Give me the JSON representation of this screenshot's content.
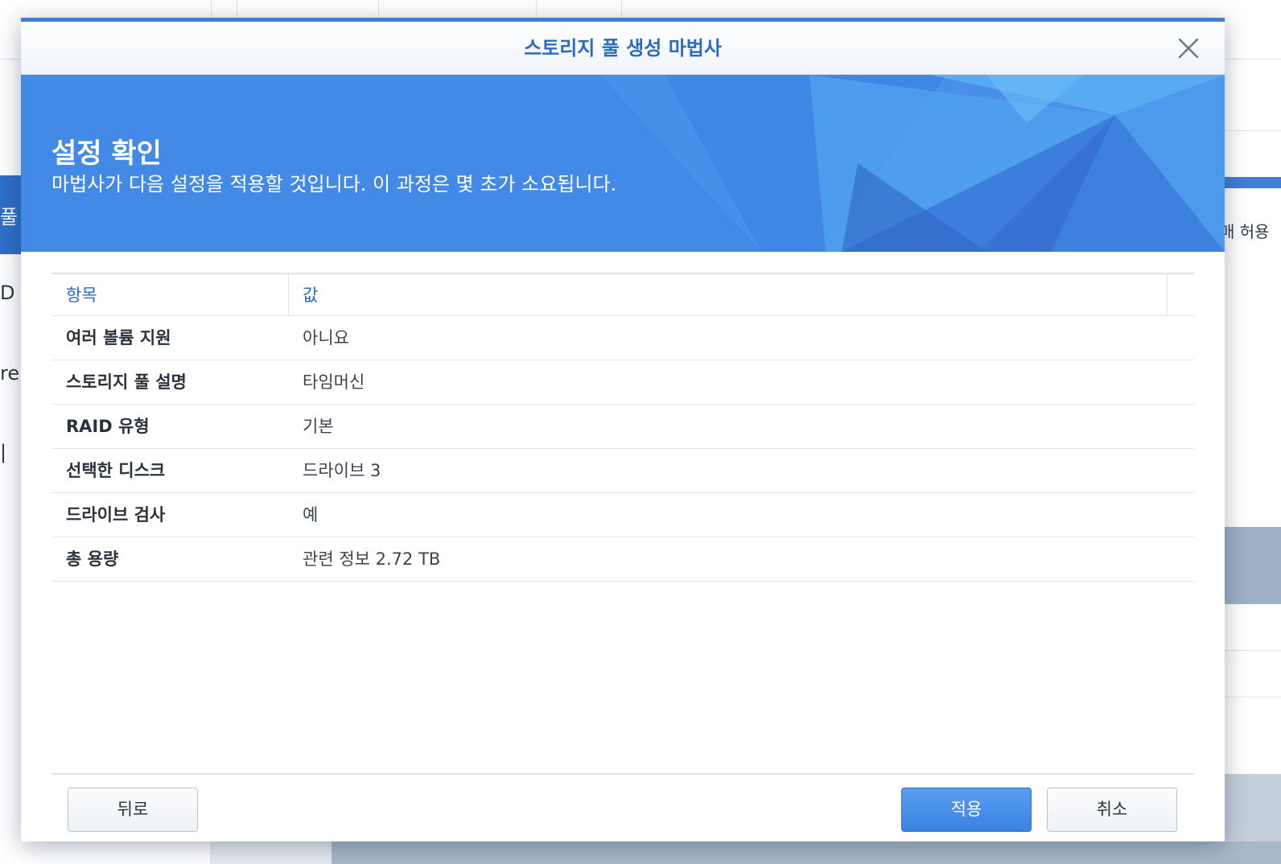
{
  "background": {
    "sidebar_fragments": [
      "풀",
      "D",
      "re",
      "|"
    ],
    "right_fragment": "매 허용"
  },
  "dialog": {
    "title": "스토리지 풀 생성 마법사",
    "close_icon": "close-icon",
    "banner": {
      "heading": "설정 확인",
      "subtitle": "마법사가 다음 설정을 적용할 것입니다. 이 과정은 몇 초가 소요됩니다."
    },
    "table": {
      "headers": [
        "항목",
        "값"
      ],
      "rows": [
        {
          "key": "여러 볼륨 지원",
          "value": "아니요"
        },
        {
          "key": "스토리지 풀 설명",
          "value": "타임머신"
        },
        {
          "key": "RAID 유형",
          "value": "기본"
        },
        {
          "key": "선택한 디스크",
          "value": "드라이브 3"
        },
        {
          "key": "드라이브 검사",
          "value": "예"
        },
        {
          "key": "총 용량",
          "value": "관련 정보 2.72 TB"
        }
      ]
    },
    "buttons": {
      "back": "뒤로",
      "apply": "적용",
      "cancel": "취소"
    }
  },
  "colors": {
    "accent": "#3f7fd6",
    "banner": "#4389e6",
    "title_text": "#2b6bc0"
  }
}
